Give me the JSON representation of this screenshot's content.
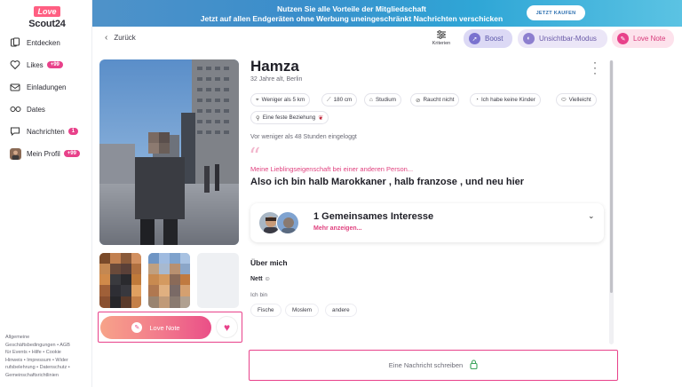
{
  "app": {
    "logo_top": "Love",
    "logo_bottom": "Scout24"
  },
  "sidebar": {
    "items": [
      {
        "label": "Entdecken",
        "icon": "cards-icon",
        "badge": ""
      },
      {
        "label": "Likes",
        "icon": "heart-icon",
        "badge": "+99"
      },
      {
        "label": "Einladungen",
        "icon": "envelope-icon",
        "badge": ""
      },
      {
        "label": "Dates",
        "icon": "glasses-icon",
        "badge": ""
      },
      {
        "label": "Nachrichten",
        "icon": "chat-icon",
        "badge": "1"
      },
      {
        "label": "Mein Profil",
        "icon": "avatar-icon",
        "badge": "+99"
      }
    ],
    "footer_lines": [
      "Allgemeine",
      "Geschäftsbedingungen • AGB",
      "für Events • Hilfe • Cookie",
      "Hinweis • Impressum • Wider",
      "rufsbelehrung • Datenschutz •",
      "Gemeinschaftsrichtlinien"
    ]
  },
  "banner": {
    "line1": "Nutzen Sie alle Vorteile der Mitgliedschaft",
    "line2": "Jetzt auf allen Endgeräten ohne Werbung uneingeschränkt Nachrichten verschicken",
    "cta": "JETZT KAUFEN",
    "colors": {
      "from": "#4f92c9",
      "to": "#5bc3e3"
    }
  },
  "toolbar": {
    "back": "Zurück",
    "filter": "Kriterien",
    "boost": "Boost",
    "invisible": "Unsichtbar-Modus",
    "love_note": "Love Note"
  },
  "profile": {
    "name": "Hamza",
    "age_city": "32 Jahre alt, Berlin",
    "tags": [
      {
        "icon": "location-icon",
        "label": "Weniger als 5 km"
      },
      {
        "icon": "ruler-icon",
        "label": "180 cm"
      },
      {
        "icon": "graduation-icon",
        "label": "Studium"
      },
      {
        "icon": "no-smoking-icon",
        "label": "Raucht nicht"
      },
      {
        "icon": "stroller-icon",
        "label": "Ich habe keine Kinder"
      },
      {
        "icon": "pill-icon",
        "label": "Vielleicht"
      },
      {
        "icon": "search-icon",
        "label": "Eine feste Beziehung"
      }
    ],
    "last_login": "Vor weniger als 48 Stunden eingeloggt",
    "question": "Meine Lieblingseigenschaft bei einer anderen Person...",
    "answer": "Also ich bin halb Marokkaner , halb franzose , und neu hier",
    "interests": {
      "title": "1 Gemeinsames Interesse",
      "more": "Mehr anzeigen..."
    },
    "about": {
      "title": "Über mich",
      "nett": "Nett ☺",
      "ich_bin": "Ich bin",
      "chips": [
        "Fische",
        "Moslem",
        "andere"
      ]
    },
    "photos_count": 4
  },
  "actions": {
    "love_note": "Love Note",
    "message_placeholder": "Eine Nachricht schreiben"
  },
  "colors": {
    "accent_pink": "#e8418a",
    "boost_bg": "#dcd9f5",
    "invisible_bg": "#ebe6f7",
    "love_note_bg": "#fde2ec"
  }
}
